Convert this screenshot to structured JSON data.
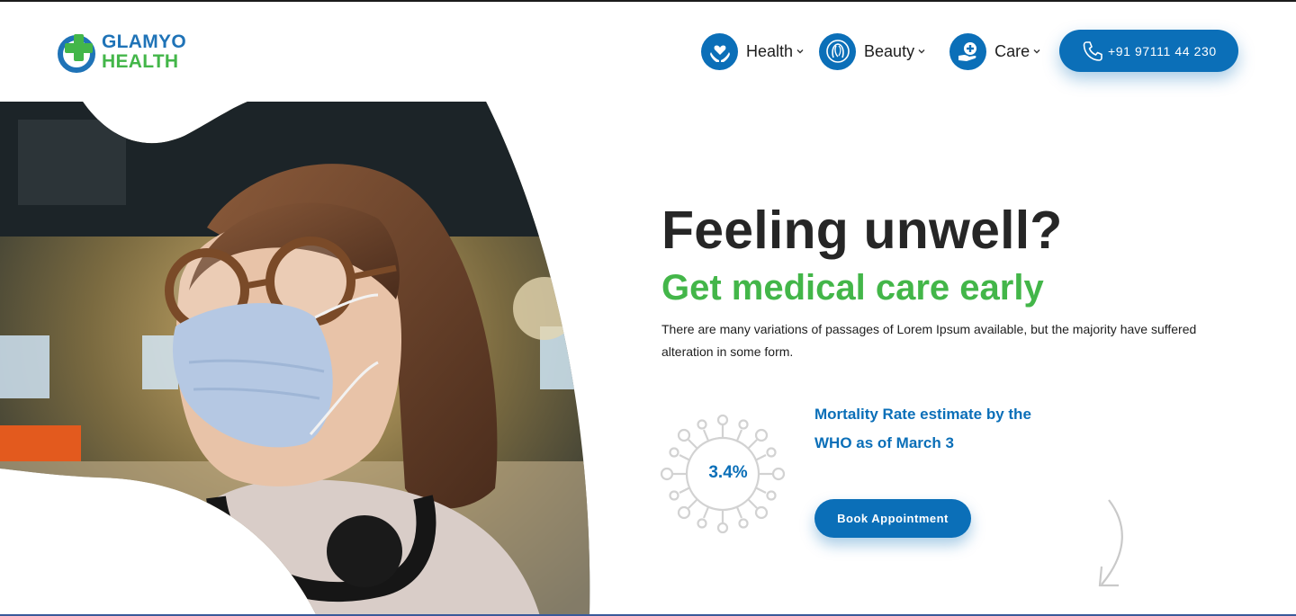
{
  "brand": {
    "line1": "GLAMYO",
    "line2": "HEALTH",
    "colors": {
      "blue": "#1f73b7",
      "green": "#43b649"
    }
  },
  "nav": {
    "items": [
      {
        "label": "Health",
        "icon": "hand-heart-icon"
      },
      {
        "label": "Beauty",
        "icon": "woman-face-icon"
      },
      {
        "label": "Care",
        "icon": "hand-medical-cross-icon"
      }
    ],
    "phone": {
      "icon": "phone-icon",
      "number": "+91 97111 44 230"
    }
  },
  "hero": {
    "image": "woman-wearing-face-mask-photo",
    "headline": "Feeling unwell?",
    "subheadline": "Get medical care early",
    "description": "There are many variations of passages of Lorem Ipsum available, but the majority have suffered alteration in some form."
  },
  "stat": {
    "icon": "virus-icon",
    "value": "3.4%",
    "label": "Mortality Rate estimate by the WHO as of March 3"
  },
  "cta": {
    "label": "Book Appointment"
  },
  "decor": {
    "arrow": "curved-down-arrow-icon"
  },
  "colors": {
    "primary": "#0b6fb8",
    "accent": "#43b649",
    "heading": "#262626"
  }
}
